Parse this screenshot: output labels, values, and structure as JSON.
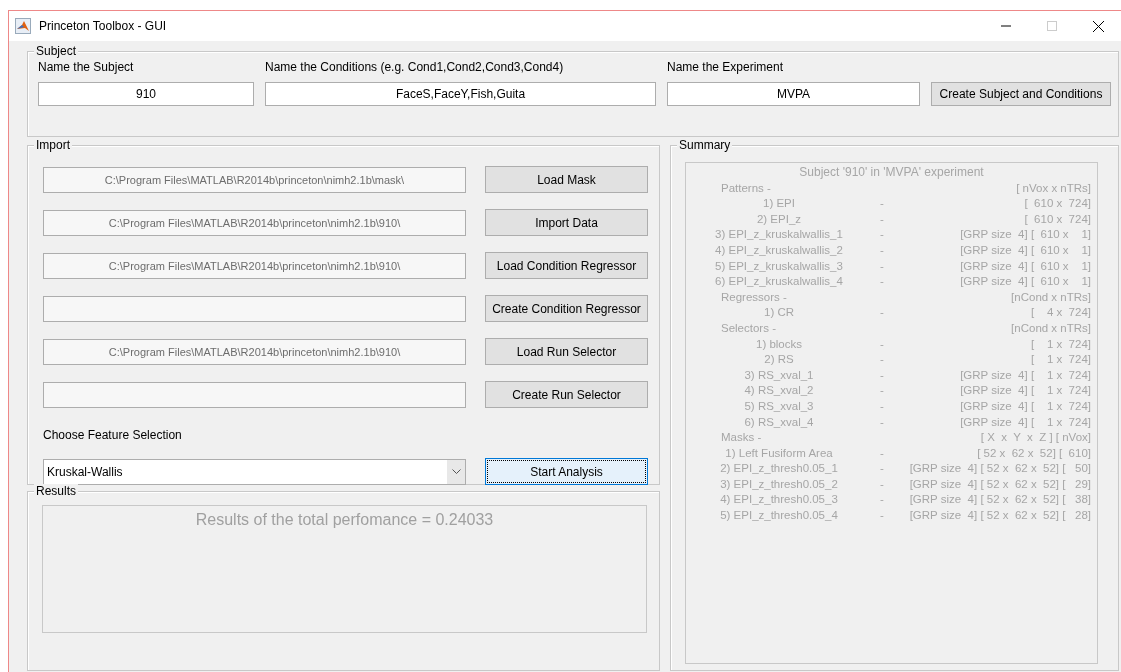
{
  "window": {
    "title": "Princeton Toolbox - GUI"
  },
  "subject": {
    "title": "Subject",
    "fields": [
      {
        "label": "Name the Subject",
        "value": "910"
      },
      {
        "label": "Name the Conditions (e.g. Cond1,Cond2,Cond3,Cond4)",
        "value": "FaceS,FaceY,Fish,Guita"
      },
      {
        "label": "Name the Experiment",
        "value": "MVPA"
      }
    ],
    "button": "Create Subject and Conditions"
  },
  "import": {
    "title": "Import",
    "rows": [
      {
        "path": "C:\\Program Files\\MATLAB\\R2014b\\princeton\\nimh2.1b\\mask\\",
        "button": "Load Mask"
      },
      {
        "path": "C:\\Program Files\\MATLAB\\R2014b\\princeton\\nimh2.1b\\910\\",
        "button": "Import Data"
      },
      {
        "path": "C:\\Program Files\\MATLAB\\R2014b\\princeton\\nimh2.1b\\910\\",
        "button": "Load Condition Regressor"
      },
      {
        "button": "Create Condition Regressor"
      },
      {
        "path": "C:\\Program Files\\MATLAB\\R2014b\\princeton\\nimh2.1b\\910\\",
        "button": "Load Run Selector"
      },
      {
        "button": "Create Run Selector"
      }
    ],
    "feature_label": "Choose Feature Selection",
    "feature_value": "Kruskal-Wallis",
    "start_button": {
      "label": "Start Analysis",
      "focused": true
    }
  },
  "results": {
    "title": "Results",
    "text": "Results of the total perfomance = 0.24033"
  },
  "summary": {
    "title": "Summary",
    "heading": "Subject '910' in 'MVPA' experiment",
    "lines": [
      {
        "kind": "header",
        "name": "Patterns -",
        "value": "[ nVox x nTRs]"
      },
      {
        "kind": "item",
        "name": "1) EPI",
        "dash": "-",
        "value": "[  610 x  724]"
      },
      {
        "kind": "item",
        "name": "2) EPI_z",
        "dash": "-",
        "value": "[  610 x  724]"
      },
      {
        "kind": "item",
        "name": "3) EPI_z_kruskalwallis_1",
        "dash": "-",
        "value": "[GRP size  4] [  610 x    1]"
      },
      {
        "kind": "item",
        "name": "4) EPI_z_kruskalwallis_2",
        "dash": "-",
        "value": "[GRP size  4] [  610 x    1]"
      },
      {
        "kind": "item",
        "name": "5) EPI_z_kruskalwallis_3",
        "dash": "-",
        "value": "[GRP size  4] [  610 x    1]"
      },
      {
        "kind": "item",
        "name": "6) EPI_z_kruskalwallis_4",
        "dash": "-",
        "value": "[GRP size  4] [  610 x    1]"
      },
      {
        "kind": "header",
        "name": "Regressors -",
        "value": "[nCond x nTRs]"
      },
      {
        "kind": "item",
        "name": "1) CR",
        "dash": "-",
        "value": "[    4 x  724]"
      },
      {
        "kind": "header",
        "name": "Selectors -",
        "value": "[nCond x nTRs]"
      },
      {
        "kind": "item",
        "name": "1) blocks",
        "dash": "-",
        "value": "[    1 x  724]"
      },
      {
        "kind": "item",
        "name": "2) RS",
        "dash": "-",
        "value": "[    1 x  724]"
      },
      {
        "kind": "item",
        "name": "3) RS_xval_1",
        "dash": "-",
        "value": "[GRP size  4] [    1 x  724]"
      },
      {
        "kind": "item",
        "name": "4) RS_xval_2",
        "dash": "-",
        "value": "[GRP size  4] [    1 x  724]"
      },
      {
        "kind": "item",
        "name": "5) RS_xval_3",
        "dash": "-",
        "value": "[GRP size  4] [    1 x  724]"
      },
      {
        "kind": "item",
        "name": "6) RS_xval_4",
        "dash": "-",
        "value": "[GRP size  4] [    1 x  724]"
      },
      {
        "kind": "header",
        "name": "Masks -",
        "value": "[ X  x  Y  x  Z ] [ nVox]"
      },
      {
        "kind": "item",
        "name": "1) Left Fusiform Area",
        "dash": "-",
        "value": "[ 52 x  62 x  52] [  610]"
      },
      {
        "kind": "item",
        "name": "2) EPI_z_thresh0.05_1",
        "dash": "-",
        "value": "[GRP size  4] [ 52 x  62 x  52] [   50]"
      },
      {
        "kind": "item",
        "name": "3) EPI_z_thresh0.05_2",
        "dash": "-",
        "value": "[GRP size  4] [ 52 x  62 x  52] [   29]"
      },
      {
        "kind": "item",
        "name": "4) EPI_z_thresh0.05_3",
        "dash": "-",
        "value": "[GRP size  4] [ 52 x  62 x  52] [   38]"
      },
      {
        "kind": "item",
        "name": "5) EPI_z_thresh0.05_4",
        "dash": "-",
        "value": "[GRP size  4] [ 52 x  62 x  52] [   28]"
      }
    ]
  }
}
